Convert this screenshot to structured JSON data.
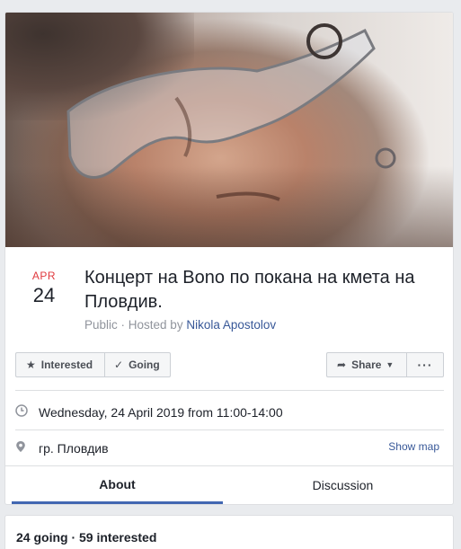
{
  "event": {
    "month": "APR",
    "day": "24",
    "title": "Концерт на Bono по покана на кмета на Пловдив.",
    "privacy": "Public",
    "separator": " · ",
    "hosted_by_label": "Hosted by ",
    "host": "Nikola Apostolov"
  },
  "actions": {
    "interested": "Interested",
    "going": "Going",
    "share": "Share",
    "more": "···"
  },
  "details": {
    "datetime": "Wednesday, 24 April 2019 from 11:00-14:00",
    "location": "гр. Пловдив",
    "show_map": "Show map"
  },
  "tabs": [
    {
      "label": "About",
      "active": true
    },
    {
      "label": "Discussion",
      "active": false
    }
  ],
  "stats": {
    "going": "24 going",
    "separator": " · ",
    "interested": "59 interested"
  },
  "colors": {
    "accent": "#4267b2",
    "link": "#385898",
    "date_month": "#e0393e",
    "muted": "#90949c"
  },
  "icons": {
    "interested": "star-icon",
    "going": "check-icon",
    "share": "share-arrow-icon",
    "share_menu": "caret-down-icon",
    "time": "clock-icon",
    "location": "pin-icon"
  }
}
